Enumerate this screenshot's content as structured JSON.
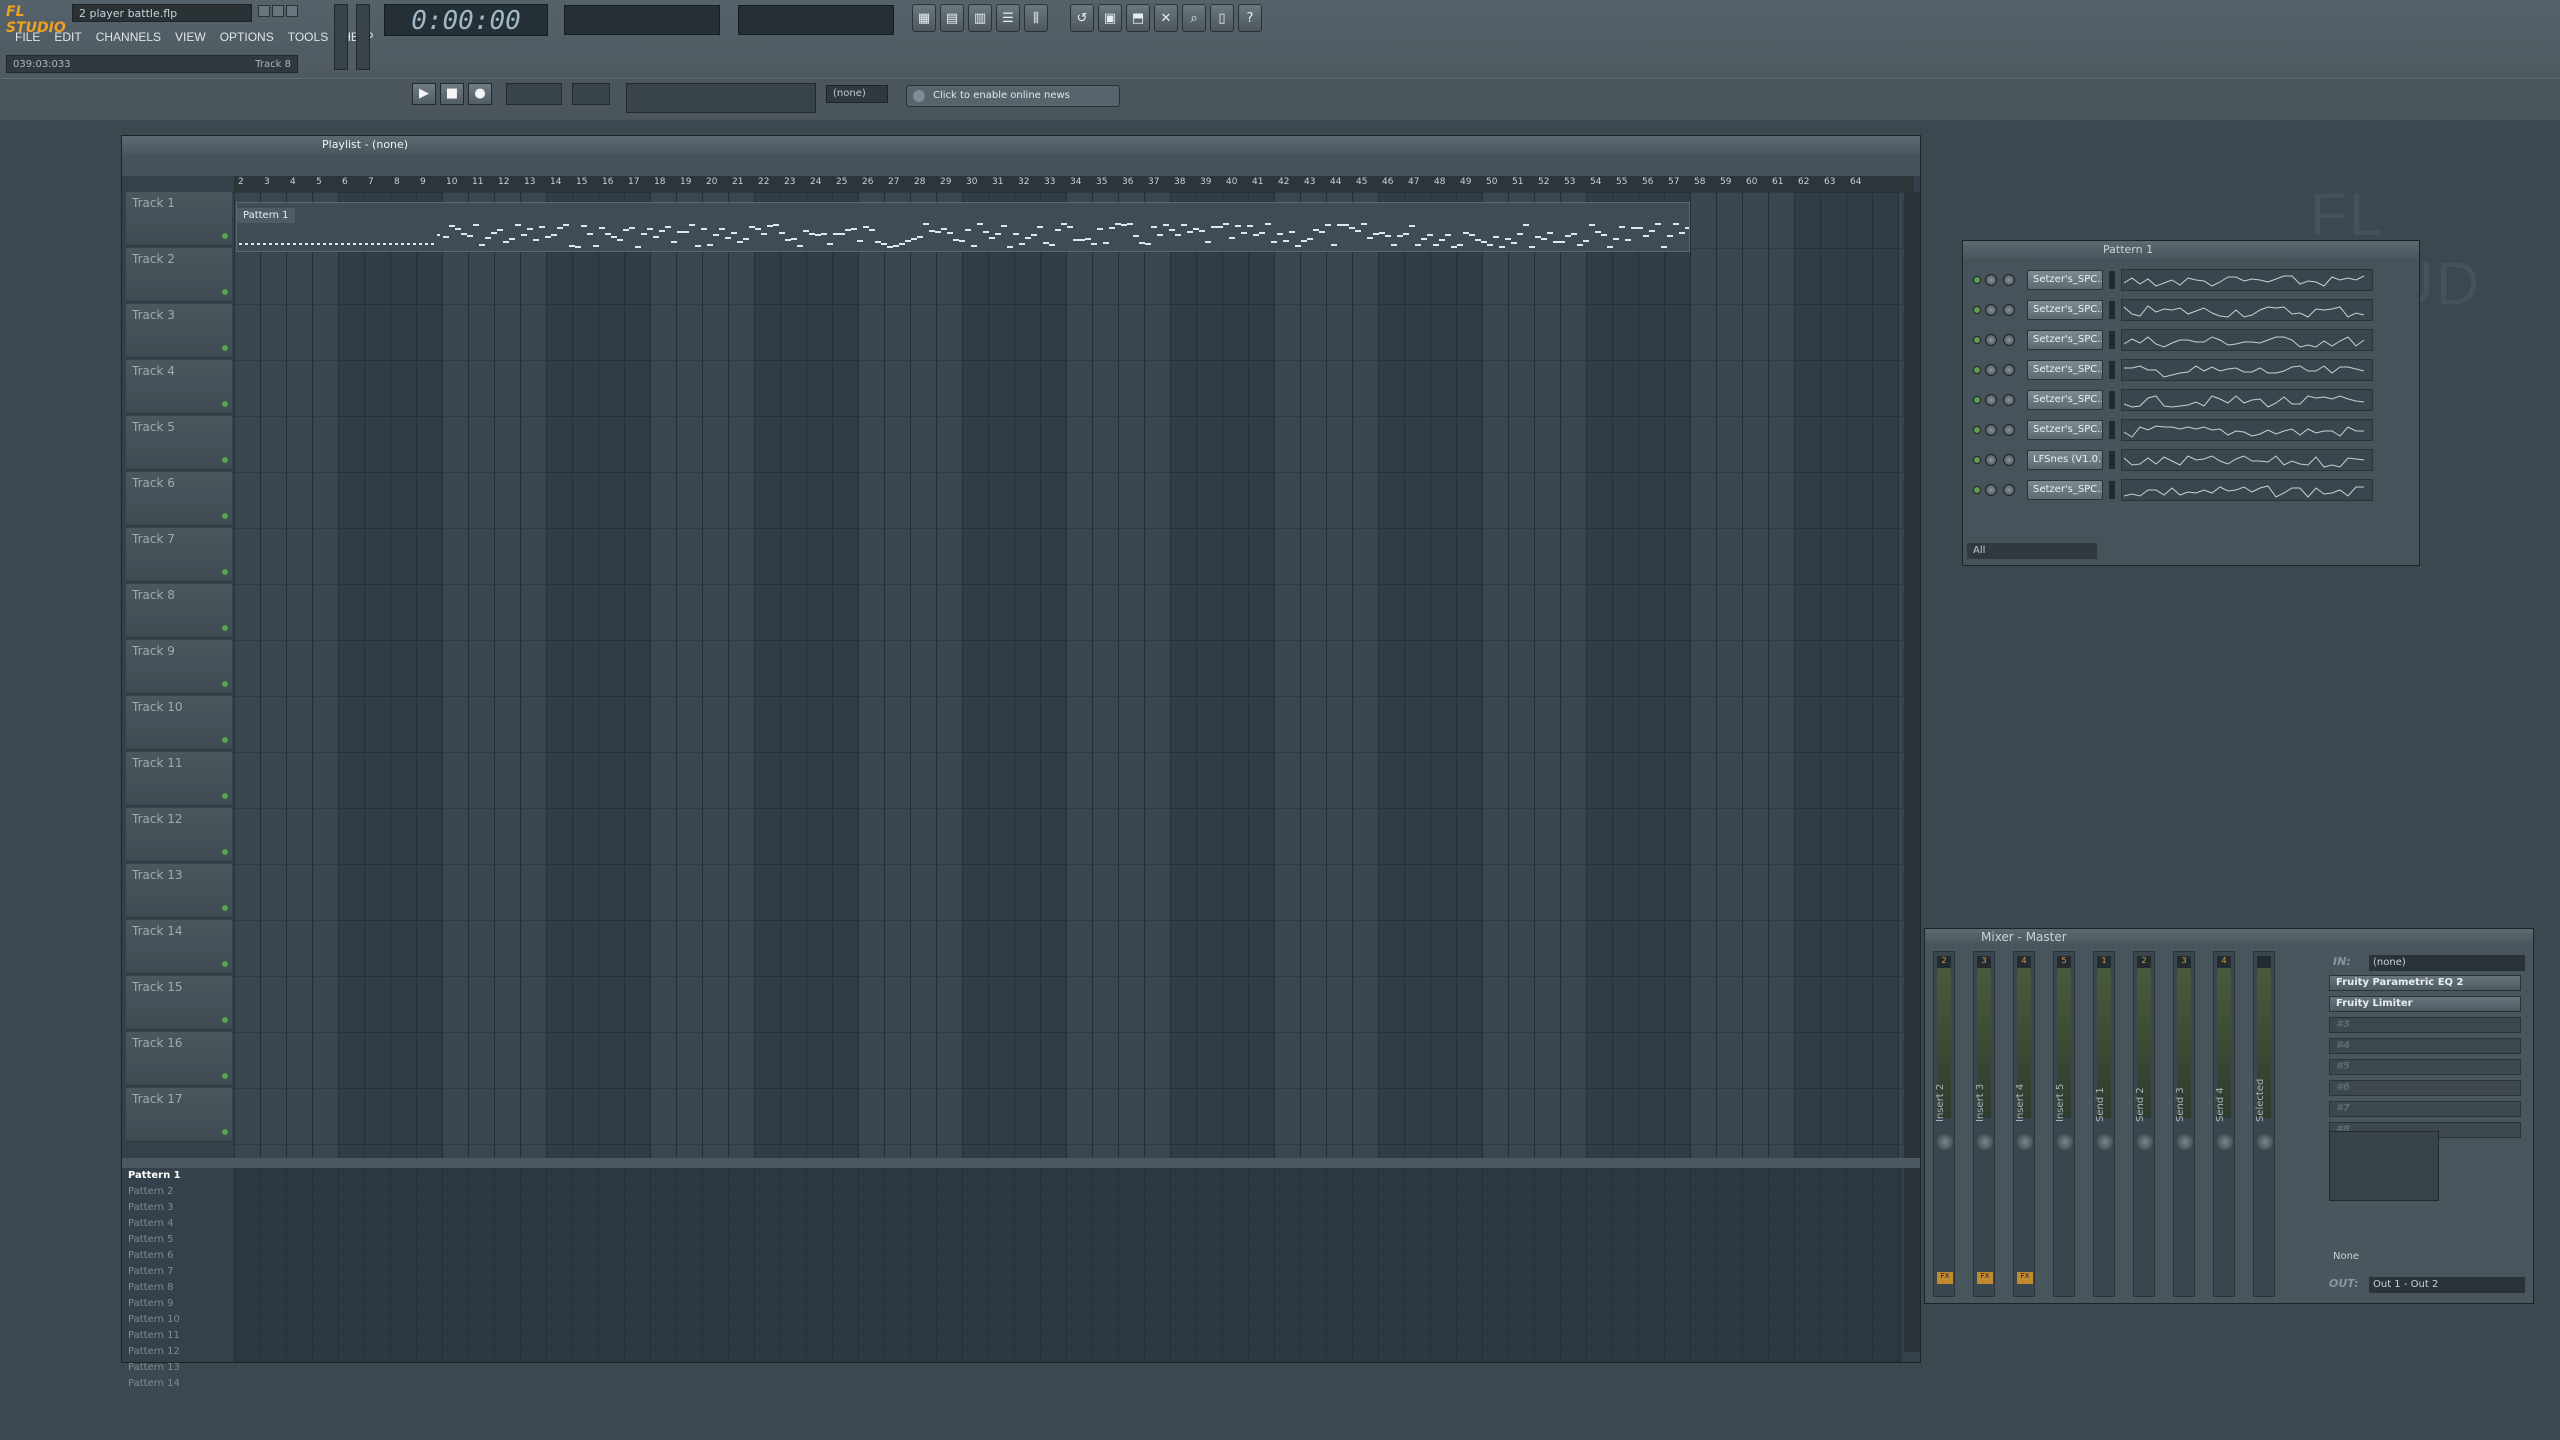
{
  "app": {
    "logo": "FL STUDIO",
    "project_title": "2 player battle.flp",
    "menu": [
      "FILE",
      "EDIT",
      "CHANNELS",
      "VIEW",
      "OPTIONS",
      "TOOLS",
      "HELP"
    ],
    "hint_left": "039:03:033",
    "hint_right": "Track 8",
    "time": "0:00:00",
    "pattern_selector": "(none)",
    "news_button": "Click to enable online news",
    "watermark": "FL STUD"
  },
  "playlist": {
    "title": "Playlist - (none)",
    "ruler": [
      "2",
      "3",
      "4",
      "5",
      "6",
      "7",
      "8",
      "9",
      "10",
      "11",
      "12",
      "13",
      "14",
      "15",
      "16",
      "17",
      "18",
      "19",
      "20",
      "21",
      "22",
      "23",
      "24",
      "25",
      "26",
      "27",
      "28",
      "29",
      "30",
      "31",
      "32",
      "33",
      "34",
      "35",
      "36",
      "37",
      "38",
      "39",
      "40",
      "41",
      "42",
      "43",
      "44",
      "45",
      "46",
      "47",
      "48",
      "49",
      "50",
      "51",
      "52",
      "53",
      "54",
      "55",
      "56",
      "57",
      "58",
      "59",
      "60",
      "61",
      "62",
      "63",
      "64"
    ],
    "tracks": [
      "Track 1",
      "Track 2",
      "Track 3",
      "Track 4",
      "Track 5",
      "Track 6",
      "Track 7",
      "Track 8",
      "Track 9",
      "Track 10",
      "Track 11",
      "Track 12",
      "Track 13",
      "Track 14",
      "Track 15",
      "Track 16",
      "Track 17"
    ],
    "clip_label": "Pattern 1",
    "patterns": [
      "Pattern 1",
      "Pattern 2",
      "Pattern 3",
      "Pattern 4",
      "Pattern 5",
      "Pattern 6",
      "Pattern 7",
      "Pattern 8",
      "Pattern 9",
      "Pattern 10",
      "Pattern 11",
      "Pattern 12",
      "Pattern 13",
      "Pattern 14"
    ],
    "selected_pattern": "Pattern 1"
  },
  "channel_rack": {
    "title": "Pattern 1",
    "channels": [
      "Setzer's_SPC...",
      "Setzer's_SPC...",
      "Setzer's_SPC...",
      "Setzer's_SPC...",
      "Setzer's_SPC...",
      "Setzer's_SPC...",
      "LFSnes (V1.0...",
      "Setzer's_SPC..."
    ],
    "filter": "All"
  },
  "mixer": {
    "title": "Mixer - Master",
    "strips": [
      {
        "name": "Insert 2",
        "num": "2",
        "fx": true
      },
      {
        "name": "Insert 3",
        "num": "3",
        "fx": true
      },
      {
        "name": "Insert 4",
        "num": "4",
        "fx": true
      },
      {
        "name": "Insert 5",
        "num": "5",
        "fx": false
      },
      {
        "name": "Send 1",
        "num": "1",
        "fx": false
      },
      {
        "name": "Send 2",
        "num": "2",
        "fx": false
      },
      {
        "name": "Send 3",
        "num": "3",
        "fx": false
      },
      {
        "name": "Send 4",
        "num": "4",
        "fx": false
      },
      {
        "name": "Selected",
        "num": "",
        "fx": false
      }
    ],
    "in_label": "IN:",
    "in_value": "(none)",
    "slots": [
      "Fruity Parametric EQ 2",
      "Fruity Limiter",
      "#3",
      "#4",
      "#5",
      "#6",
      "#7",
      "#8"
    ],
    "preset": "None",
    "out_label": "OUT:",
    "out_value": "Out 1 - Out 2"
  }
}
